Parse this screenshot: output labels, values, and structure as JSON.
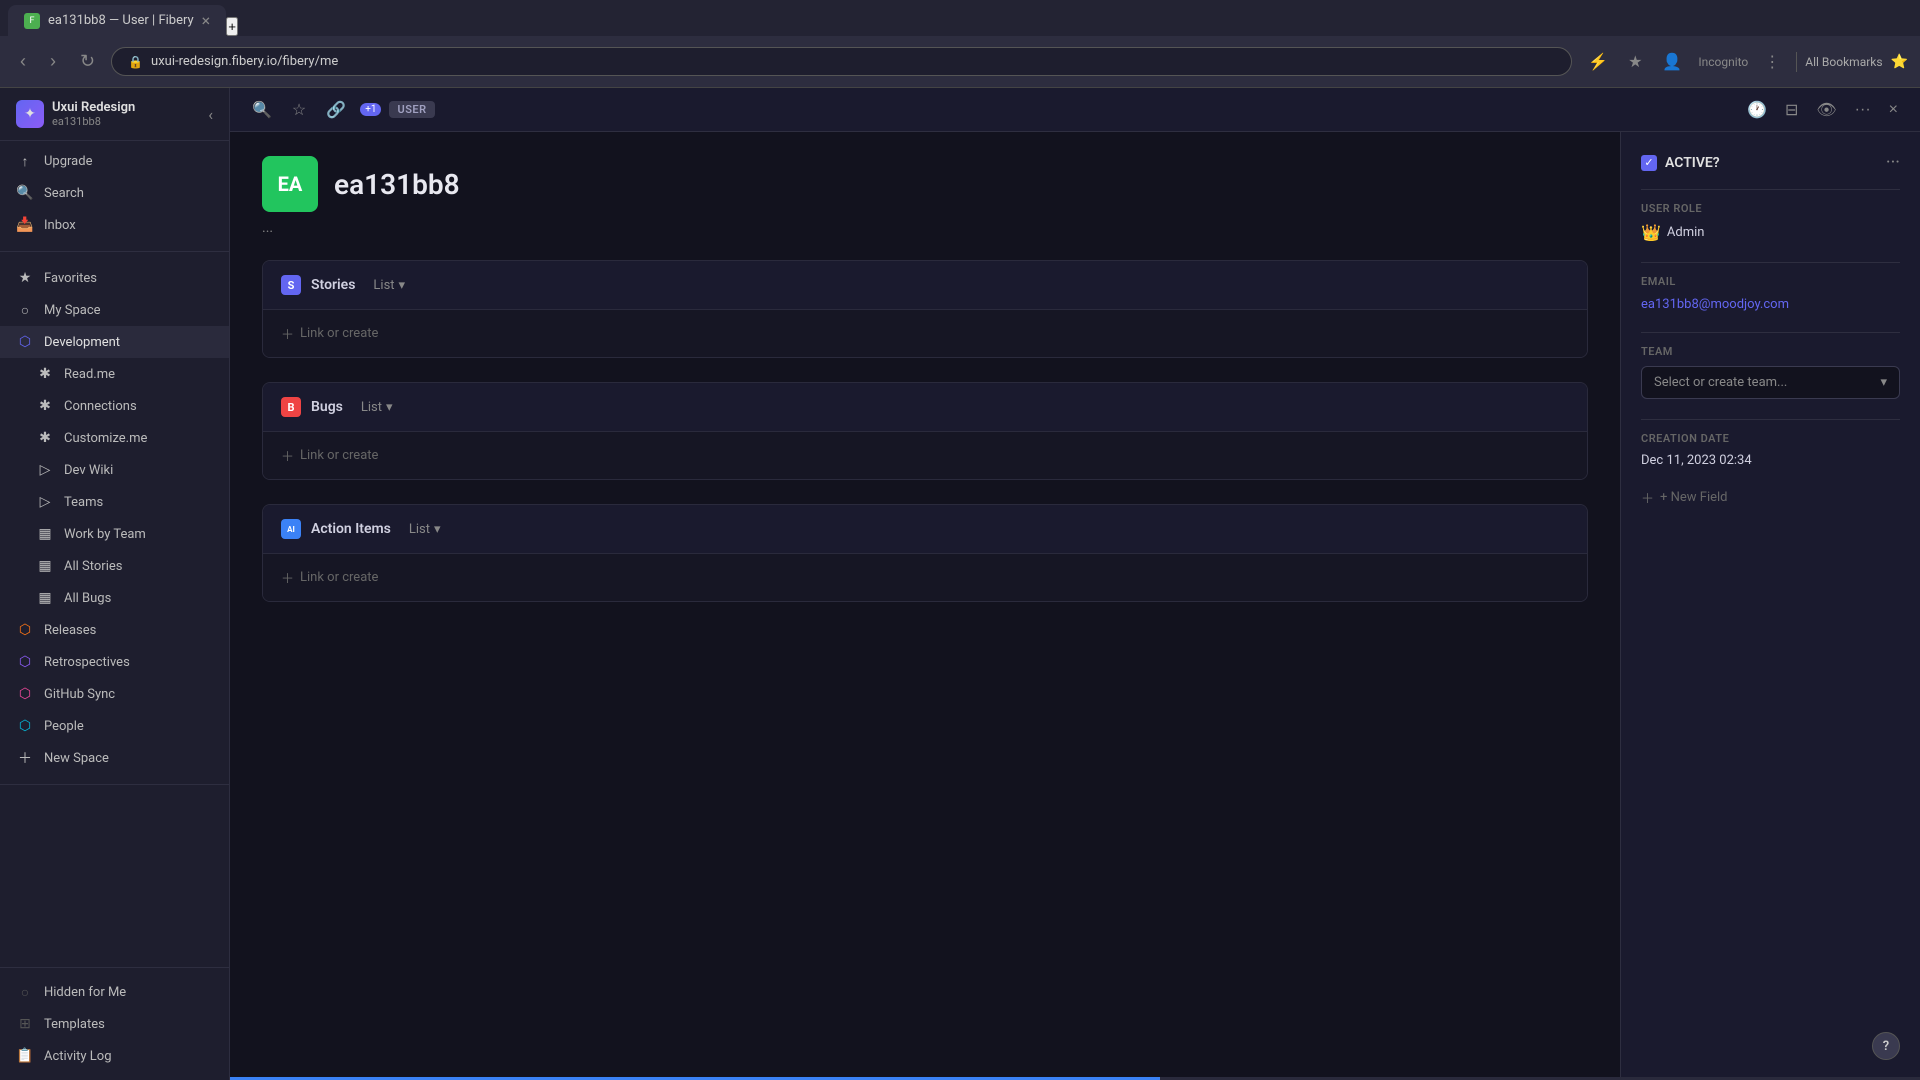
{
  "browser": {
    "tab_title": "ea131bb8 — User | Fibery",
    "tab_new_label": "+",
    "address": "uxui-redesign.fibery.io/fibery/me",
    "incognito_label": "Incognito",
    "bookmarks_label": "All Bookmarks"
  },
  "sidebar": {
    "workspace_name": "Uxui Redesign",
    "workspace_sub": "ea131bb8",
    "upgrade_label": "Upgrade",
    "search_label": "Search",
    "inbox_label": "Inbox",
    "favorites_label": "Favorites",
    "my_space_label": "My Space",
    "development_label": "Development",
    "items": [
      {
        "label": "Read.me",
        "icon": "✱"
      },
      {
        "label": "Connections",
        "icon": "✱"
      },
      {
        "label": "Customize.me",
        "icon": "✱"
      },
      {
        "label": "Dev Wiki",
        "icon": "▷"
      },
      {
        "label": "Teams",
        "icon": "▷"
      },
      {
        "label": "Work by Team",
        "icon": "▦"
      },
      {
        "label": "All Stories",
        "icon": "▦"
      },
      {
        "label": "All Bugs",
        "icon": "▦"
      }
    ],
    "releases_label": "Releases",
    "retrospectives_label": "Retrospectives",
    "github_sync_label": "GitHub Sync",
    "people_label": "People",
    "new_space_label": "New Space",
    "hidden_label": "Hidden for Me",
    "templates_label": "Templates",
    "activity_log_label": "Activity Log"
  },
  "toolbar": {
    "badge": "+1",
    "tag": "USER",
    "star_label": "★",
    "link_label": "🔗"
  },
  "user": {
    "avatar_initials": "EA",
    "name": "ea131bb8",
    "meta": "..."
  },
  "sections": [
    {
      "id": "stories",
      "icon_bg": "#6366f1",
      "icon_letter": "S",
      "title": "Stories",
      "view": "List",
      "link_or_create": "+ Link or create"
    },
    {
      "id": "bugs",
      "icon_bg": "#ef4444",
      "icon_letter": "B",
      "title": "Bugs",
      "view": "List",
      "link_or_create": "+ Link or create"
    },
    {
      "id": "action_items",
      "icon_bg": "#3b82f6",
      "icon_letter": "AI",
      "title": "Action Items",
      "view": "List",
      "link_or_create": "+ Link or create"
    }
  ],
  "right_panel": {
    "active_label": "ACTIVE?",
    "active_checked": true,
    "more_icon": "···",
    "user_role_label": "USER ROLE",
    "role_value": "Admin",
    "role_icon": "👑",
    "email_label": "EMAIL",
    "email_value": "ea131bb8@moodjoy.com",
    "team_label": "TEAM",
    "team_placeholder": "Select or create team...",
    "creation_date_label": "CREATION DATE",
    "creation_date_value": "Dec 11, 2023 02:34",
    "new_field_label": "+ New Field"
  },
  "help_btn": "?",
  "progress_width": "55%"
}
